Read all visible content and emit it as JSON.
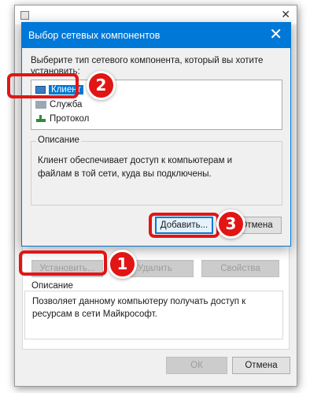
{
  "parent": {
    "close_glyph": "✕",
    "buttons": {
      "install": "Установить...",
      "remove": "Удалить",
      "properties": "Свойства",
      "ok": "ОК",
      "cancel": "Отмена"
    },
    "description_label": "Описание",
    "description_text": "Позволяет данному компьютеру получать доступ к ресурсам в сети Майкрософт."
  },
  "dialog": {
    "title": "Выбор сетевых компонентов",
    "close_glyph": "✕",
    "prompt": "Выберите тип сетевого компонента, который вы хотите установить:",
    "component_types": [
      {
        "label": "Клиент",
        "icon": "client-icon",
        "selected": true
      },
      {
        "label": "Служба",
        "icon": "service-icon",
        "selected": false
      },
      {
        "label": "Протокол",
        "icon": "protocol-icon",
        "selected": false
      }
    ],
    "description_legend": "Описание",
    "description_text": "Клиент обеспечивает доступ к компьютерам и файлам в той сети, куда вы подключены.",
    "add_button": "Добавить...",
    "cancel_button": "Отмена"
  },
  "annotations": {
    "steps": [
      "1",
      "2",
      "3"
    ],
    "color": "#e21515"
  },
  "colors": {
    "accent": "#0078d7",
    "dialog_bg": "#f0f0f0"
  }
}
